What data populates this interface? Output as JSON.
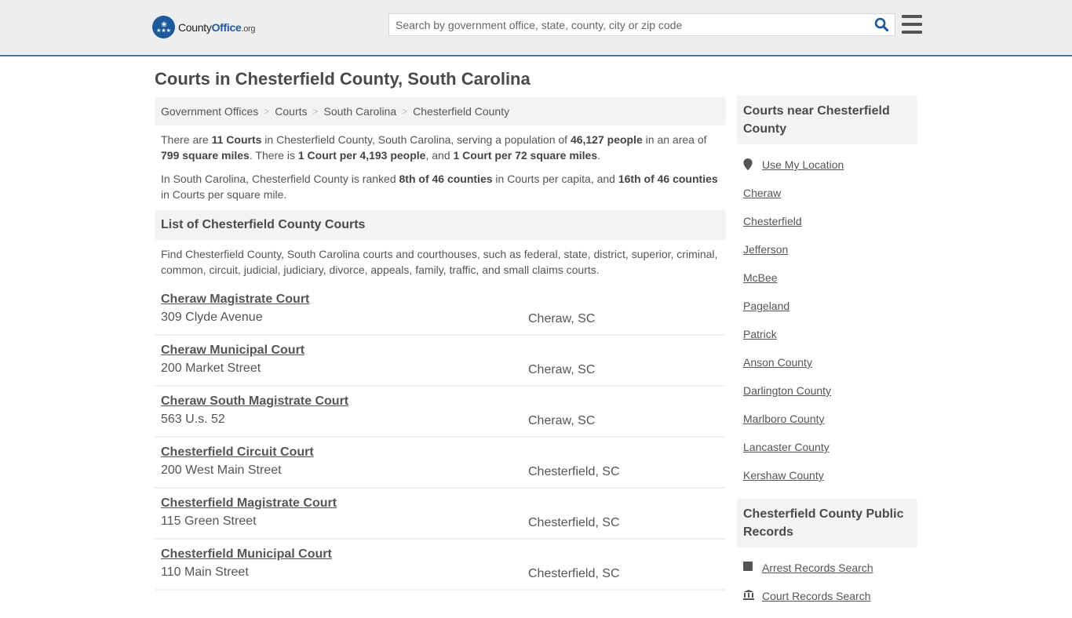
{
  "header": {
    "logo": {
      "name_part1": "County",
      "name_part2": "Office",
      "tld": ".org",
      "icon": "eagle-stars-badge-icon"
    },
    "search": {
      "placeholder": "Search by government office, state, county, city or zip code",
      "value": "",
      "icon": "search-icon"
    },
    "menu_icon": "hamburger-menu-icon",
    "colors": {
      "brand_blue": "#1c5a9c",
      "accent_border": "#3b7fb5",
      "header_bg": "#eeeeee"
    }
  },
  "page": {
    "title": "Courts in Chesterfield County, South Carolina"
  },
  "breadcrumb": [
    {
      "label": "Government Offices"
    },
    {
      "label": "Courts"
    },
    {
      "label": "South Carolina"
    },
    {
      "label": "Chesterfield County"
    }
  ],
  "breadcrumb_separator": ">",
  "intro": {
    "p1": {
      "t1": "There are ",
      "b1": "11 Courts",
      "t2": " in Chesterfield County, South Carolina, serving a population of ",
      "b2": "46,127 people",
      "t3": " in an area of ",
      "b3": "799 square miles",
      "t4": ". There is ",
      "b4": "1 Court per 4,193 people",
      "t5": ", and ",
      "b5": "1 Court per 72 square miles",
      "t6": "."
    },
    "p2": {
      "t1": "In South Carolina, Chesterfield County is ranked ",
      "b1": "8th of 46 counties",
      "t2": " in Courts per capita, and ",
      "b2": "16th of 46 counties",
      "t3": " in Courts per square mile."
    }
  },
  "list_section": {
    "heading": "List of Chesterfield County Courts",
    "description": "Find Chesterfield County, South Carolina courts and courthouses, such as federal, state, district, superior, criminal, common, circuit, judicial, judiciary, divorce, appeals, family, traffic, and small claims courts."
  },
  "courts": [
    {
      "name": "Cheraw Magistrate Court",
      "address": "309 Clyde Avenue",
      "city": "Cheraw, SC"
    },
    {
      "name": "Cheraw Municipal Court",
      "address": "200 Market Street",
      "city": "Cheraw, SC"
    },
    {
      "name": "Cheraw South Magistrate Court",
      "address": "563 U.s. 52",
      "city": "Cheraw, SC"
    },
    {
      "name": "Chesterfield Circuit Court",
      "address": "200 West Main Street",
      "city": "Chesterfield, SC"
    },
    {
      "name": "Chesterfield Magistrate Court",
      "address": "115 Green Street",
      "city": "Chesterfield, SC"
    },
    {
      "name": "Chesterfield Municipal Court",
      "address": "110 Main Street",
      "city": "Chesterfield, SC"
    }
  ],
  "sidebar": {
    "nearby": {
      "heading": "Courts near Chesterfield County",
      "use_location": {
        "label": "Use My Location",
        "icon": "map-pin-icon"
      },
      "links": [
        "Cheraw",
        "Chesterfield",
        "Jefferson",
        "McBee",
        "Pageland",
        "Patrick",
        "Anson County",
        "Darlington County",
        "Marlboro County",
        "Lancaster County",
        "Kershaw County"
      ]
    },
    "public_records": {
      "heading": "Chesterfield County Public Records",
      "links": [
        {
          "label": "Arrest Records Search",
          "icon": "square-badge-icon"
        },
        {
          "label": "Court Records Search",
          "icon": "courthouse-icon"
        }
      ]
    }
  }
}
